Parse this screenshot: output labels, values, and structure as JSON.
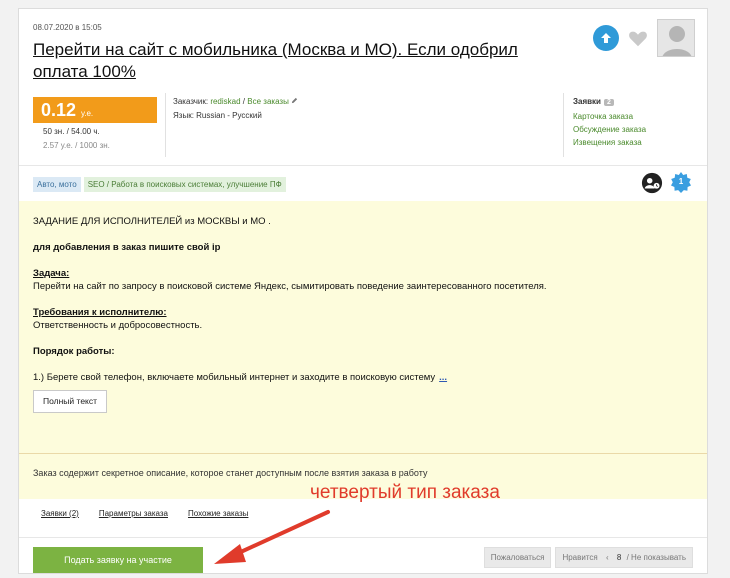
{
  "order": {
    "date": "08.07.2020 в 15:05",
    "title": "Перейти на сайт с мобильника (Москва и МО). Если одобрил оплата 100%"
  },
  "price": {
    "value": "0.12",
    "unit": "у.е.",
    "hours": "50 зн. / 54.00 ч.",
    "rate": "2.57 у.е. / 1000 зн."
  },
  "customer": {
    "label": "Заказчик:",
    "name": "rediskad",
    "sep": "/",
    "all_orders": "Все заказы",
    "lang_label": "Язык:",
    "lang_value": "Russian - Русский"
  },
  "side_links": {
    "head": "Заявки",
    "count": "2",
    "items": [
      "Карточка заказа",
      "Обсуждение заказа",
      "Извещения заказа"
    ]
  },
  "tags": [
    "Авто, мото",
    "SEO / Работа в поисковых системах, улучшение ПФ"
  ],
  "head_badge": "1",
  "description": {
    "line1": "ЗАДАНИЕ ДЛЯ ИСПОЛНИТЕЛЕЙ из МОСКВЫ и МО .",
    "line2": "для добавления в заказ пишите свой ip",
    "task_title": "Задача:",
    "task_text": "Перейти на сайт по запросу в поисковой системе Яндекс, сымитировать поведение заинтересованного посетителя.",
    "req_title": "Требования к исполнителю:",
    "req_text": "Ответственность и добросовестность.",
    "order_title": "Порядок работы:",
    "step1": "1.) Берете свой телефон, включаете мобильный интернет и заходите в поисковую систему",
    "more": "...",
    "full_text_button": "Полный текст",
    "secret": "Заказ содержит секретное описание, которое станет доступным после взятия заказа в работу"
  },
  "tabs": [
    "Заявки (2)",
    "Параметры заказа",
    "Похожие заказы"
  ],
  "annotation": "четвертый тип заказа",
  "submit_button": "Подать заявку на участие",
  "footer": {
    "complain": "Пожаловаться",
    "like": "Нравится",
    "like_sep": "‹",
    "like_count": "8",
    "hide": "/ Не показывать"
  },
  "colors": {
    "price_bg": "#f29b1a",
    "submit_bg": "#7cb342",
    "annotation": "#e03b2b",
    "desc_bg": "#fdfcdc"
  }
}
